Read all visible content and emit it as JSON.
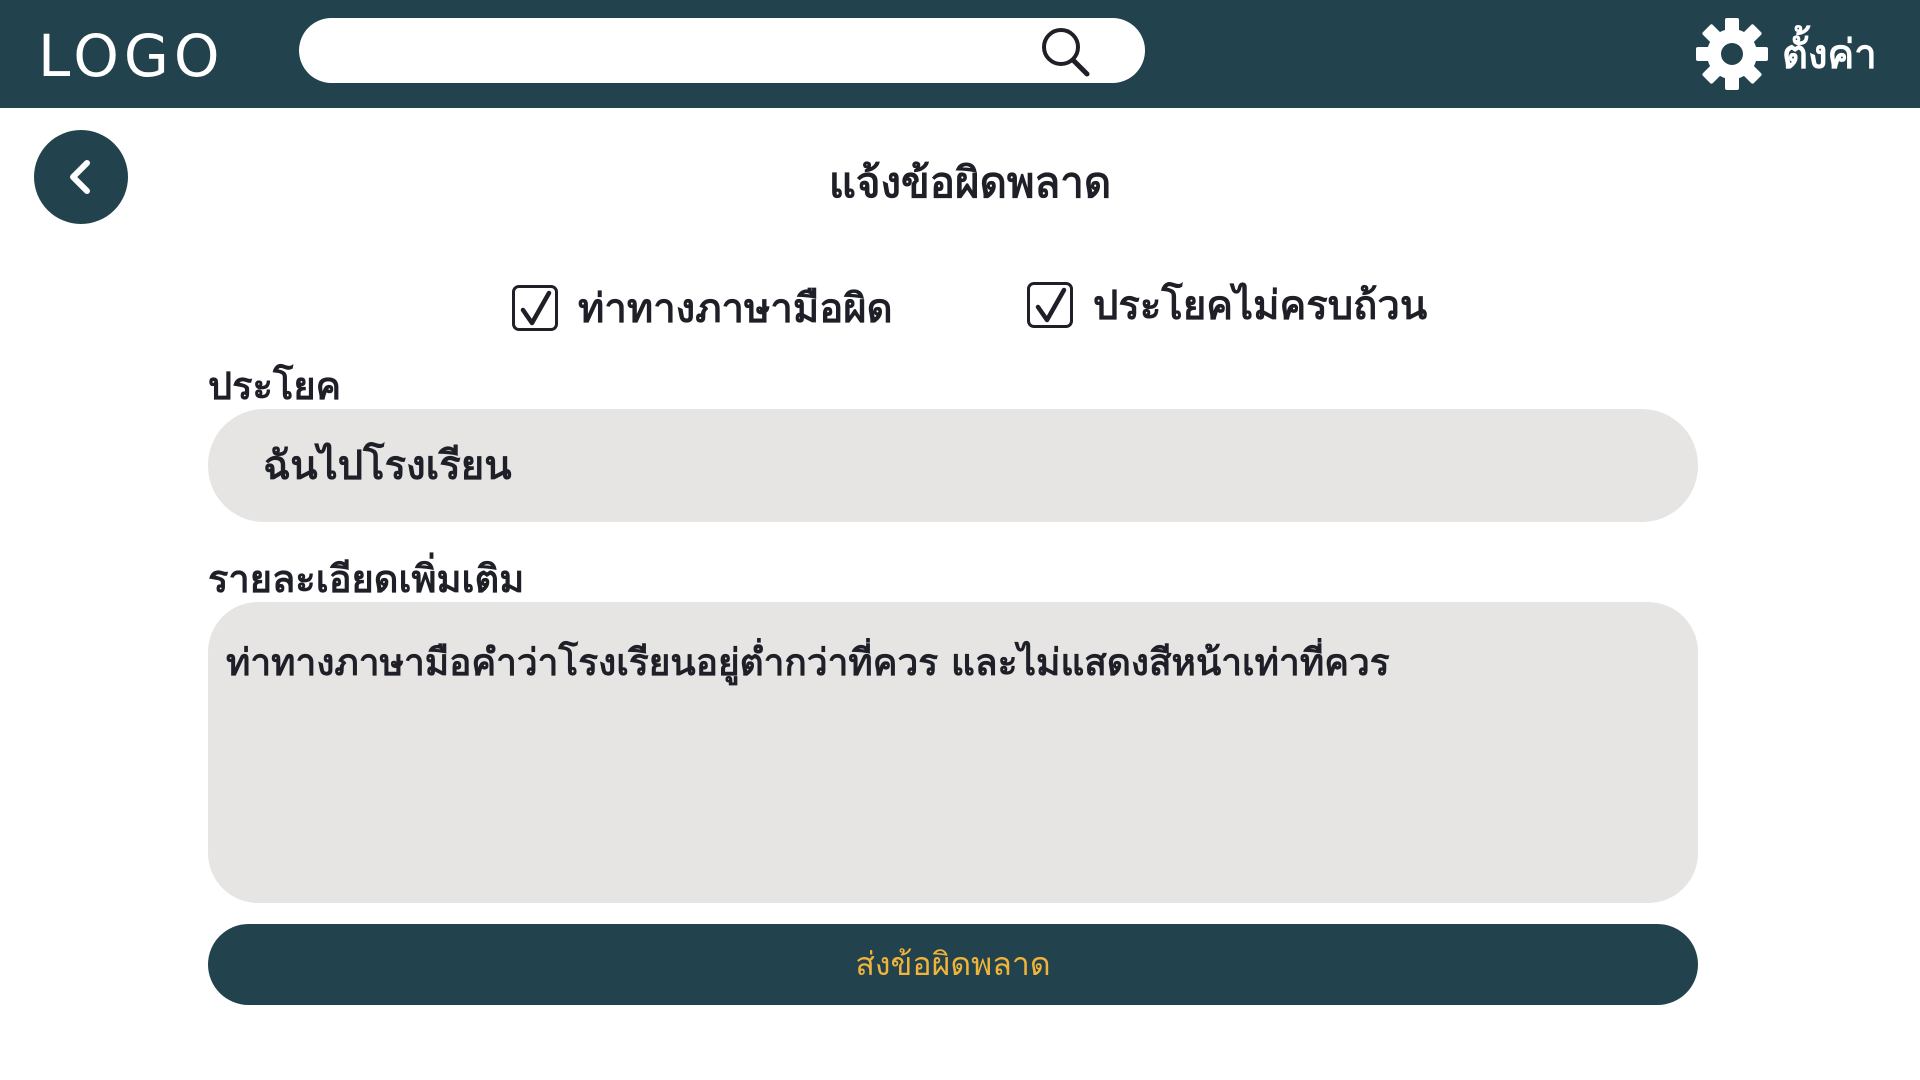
{
  "header": {
    "logo": "LOGO",
    "search": {
      "value": "",
      "placeholder": ""
    },
    "settings_label": "ตั้งค่า"
  },
  "page": {
    "title": "แจ้งข้อผิดพลาด"
  },
  "options": [
    {
      "label": "ท่าทางภาษามือผิด",
      "checked": true
    },
    {
      "label": "ประโยคไม่ครบถ้วน",
      "checked": true
    }
  ],
  "form": {
    "sentence_label": "ประโยค",
    "sentence_value": "ฉันไปโรงเรียน",
    "details_label": "รายละเอียดเพิ่มเติม",
    "details_value": "ท่าทางภาษามือคำว่าโรงเรียนอยู่ต่ำกว่าที่ควร และไม่แสดงสีหน้าเท่าที่ควร",
    "submit_label": "ส่งข้อผิดพลาด"
  },
  "icons": {
    "search": "search-icon",
    "settings": "gear-icon",
    "back": "chevron-left-icon",
    "checkmark": "checkmark-icon"
  },
  "colors": {
    "brand": "#22424d",
    "field_background": "#e6e5e4",
    "submit_text": "#f0b43a",
    "text": "#1f1f28"
  }
}
